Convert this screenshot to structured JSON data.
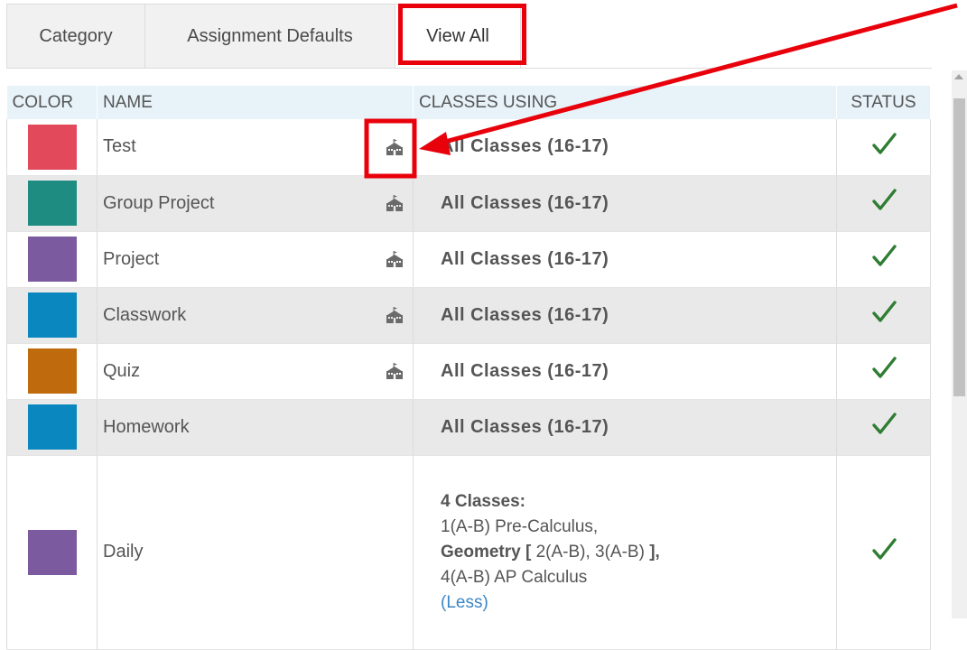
{
  "tabs": [
    {
      "label": "Category"
    },
    {
      "label": "Assignment Defaults"
    },
    {
      "label": "View All"
    }
  ],
  "table": {
    "headers": {
      "color": "COLOR",
      "name": "NAME",
      "classes": "CLASSES USING",
      "status": "STATUS"
    },
    "rows": [
      {
        "color": "#e24a5b",
        "name": "Test",
        "icon": "school-building-icon",
        "classes": "All Classes   (16-17)",
        "status": "active-checkmark"
      },
      {
        "color": "#1f8c81",
        "name": "Group Project",
        "icon": "school-building-icon",
        "classes": "All Classes   (16-17)",
        "status": "active-checkmark"
      },
      {
        "color": "#7c5aa0",
        "name": "Project",
        "icon": "school-building-icon",
        "classes": "All Classes   (16-17)",
        "status": "active-checkmark"
      },
      {
        "color": "#0a87bf",
        "name": "Classwork",
        "icon": "school-building-icon",
        "classes": "All Classes   (16-17)",
        "status": "active-checkmark"
      },
      {
        "color": "#bf6a0d",
        "name": "Quiz",
        "icon": "school-building-icon",
        "classes": "All Classes   (16-17)",
        "status": "active-checkmark"
      },
      {
        "color": "#0a87bf",
        "name": "Homework",
        "classes": "All Classes   (16-17)",
        "status": "active-checkmark"
      },
      {
        "color": "#7c5aa0",
        "name": "Daily",
        "classes_detail": {
          "count": "4 Classes:",
          "line1": "1(A-B) Pre-Calculus,",
          "geometry_label": "Geometry [",
          "geometry_sections": " 2(A-B), 3(A-B) ",
          "geometry_close": "],",
          "line3": "4(A-B) AP Calculus",
          "less_link": "(Less)"
        },
        "status": "active-checkmark"
      }
    ]
  },
  "colors": {
    "accent_annotation": "#e8000b",
    "check": "#2e7d32",
    "header_bg": "#e7f2f9",
    "link": "#3a86c8"
  }
}
